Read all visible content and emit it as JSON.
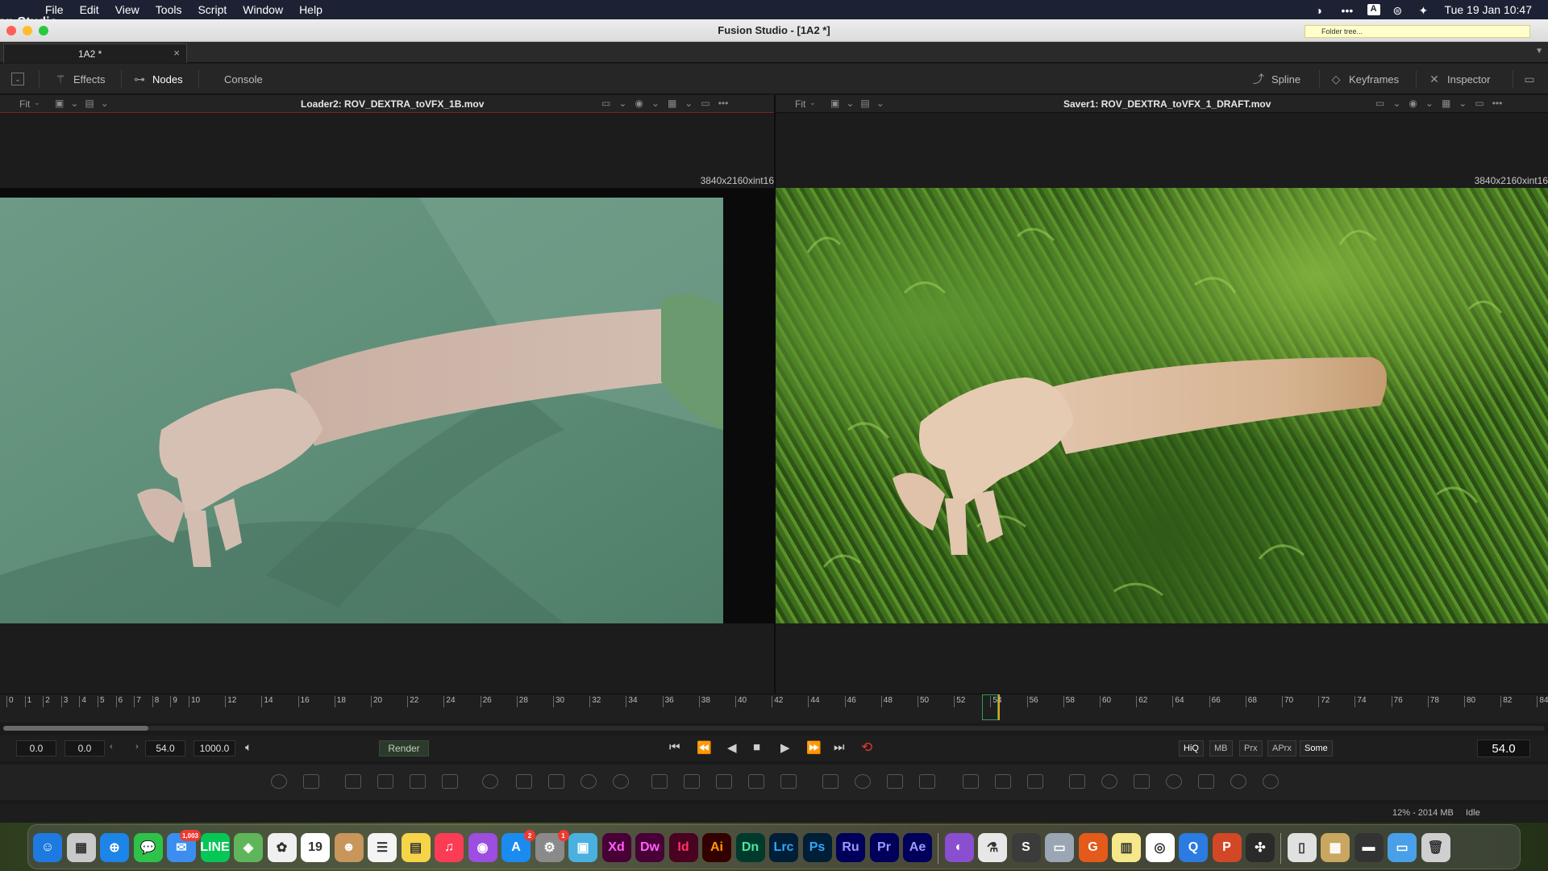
{
  "menubar": {
    "app_name": "Fusion Studio",
    "menus": [
      "File",
      "Edit",
      "View",
      "Tools",
      "Script",
      "Window",
      "Help"
    ],
    "datetime": "Tue 19 Jan  10:47",
    "input_source": "A"
  },
  "window": {
    "title": "Fusion Studio - [1A2 *]",
    "folder_tooltip": "Folder tree..."
  },
  "tab": {
    "label": "1A2 *",
    "close": "×"
  },
  "toolbar": {
    "effects": "Effects",
    "nodes": "Nodes",
    "console": "Console",
    "spline": "Spline",
    "keyframes": "Keyframes",
    "inspector": "Inspector"
  },
  "viewers": {
    "left": {
      "fit": "Fit",
      "title": "Loader2: ROV_DEXTRA_toVFX_1B.mov",
      "resolution": "3840x2160xint16"
    },
    "right": {
      "fit": "Fit",
      "title": "Saver1: ROV_DEXTRA_toVFX_1_DRAFT.mov",
      "resolution": "3840x2160xint16"
    }
  },
  "timeline": {
    "ticks": [
      "0",
      "1",
      "2",
      "3",
      "4",
      "5",
      "6",
      "7",
      "8",
      "9",
      "10",
      "12",
      "14",
      "16",
      "18",
      "20",
      "22",
      "24",
      "26",
      "28",
      "30",
      "32",
      "34",
      "36",
      "38",
      "40",
      "42",
      "44",
      "46",
      "48",
      "50",
      "52",
      "54",
      "56",
      "58",
      "60",
      "62",
      "64",
      "66",
      "68",
      "70",
      "72",
      "74",
      "76",
      "78",
      "80",
      "82",
      "84"
    ],
    "current": 54
  },
  "transport": {
    "global_start": "0.0",
    "render_start": "0.0",
    "render_end": "54.0",
    "global_end": "1000.0",
    "render_label": "Render",
    "hiq": "HiQ",
    "mb": "MB",
    "prx": "Prx",
    "aprx": "APrx",
    "some": "Some",
    "current_frame": "54.0"
  },
  "status": {
    "memory": "12% - 2014 MB",
    "state": "Idle"
  },
  "dock": {
    "apps": [
      {
        "name": "Finder",
        "label": "☺",
        "color": "#1e7ae0"
      },
      {
        "name": "Launchpad",
        "label": "▦",
        "color": "#c9c9c9"
      },
      {
        "name": "Safari",
        "label": "⊕",
        "color": "#1d84e8"
      },
      {
        "name": "Messages",
        "label": "💬",
        "color": "#2ec24a"
      },
      {
        "name": "Mail",
        "label": "✉",
        "color": "#3b8ef0",
        "badge": "1,003"
      },
      {
        "name": "LINE",
        "label": "LINE",
        "color": "#06c755"
      },
      {
        "name": "Maps",
        "label": "◈",
        "color": "#5fb65a"
      },
      {
        "name": "Photos",
        "label": "✿",
        "color": "#f0f0f0"
      },
      {
        "name": "Calendar",
        "label": "19",
        "color": "#ffffff",
        "sub": "JAN"
      },
      {
        "name": "Contacts",
        "label": "☻",
        "color": "#c8955a"
      },
      {
        "name": "Reminders",
        "label": "☰",
        "color": "#f4f4f4"
      },
      {
        "name": "Notes",
        "label": "▤",
        "color": "#f5d44a"
      },
      {
        "name": "Music",
        "label": "♫",
        "color": "#fa3d55"
      },
      {
        "name": "Podcasts",
        "label": "◉",
        "color": "#9b4ee0"
      },
      {
        "name": "App Store",
        "label": "A",
        "color": "#1a8cf0",
        "badge": "2"
      },
      {
        "name": "System Preferences",
        "label": "⚙",
        "color": "#8a8a8a",
        "badge": "1"
      },
      {
        "name": "Preview",
        "label": "▣",
        "color": "#4ab0e0"
      },
      {
        "name": "Adobe XD",
        "label": "Xd",
        "color": "#470137"
      },
      {
        "name": "Dreamweaver",
        "label": "Dw",
        "color": "#470137"
      },
      {
        "name": "InDesign",
        "label": "Id",
        "color": "#49021f"
      },
      {
        "name": "Illustrator",
        "label": "Ai",
        "color": "#330000"
      },
      {
        "name": "Dimension",
        "label": "Dn",
        "color": "#003a2d"
      },
      {
        "name": "Lightroom Classic",
        "label": "Lrc",
        "color": "#001e36"
      },
      {
        "name": "Photoshop",
        "label": "Ps",
        "color": "#001e36"
      },
      {
        "name": "Premiere Rush",
        "label": "Ru",
        "color": "#00005b"
      },
      {
        "name": "Premiere Pro",
        "label": "Pr",
        "color": "#00005b"
      },
      {
        "name": "After Effects",
        "label": "Ae",
        "color": "#00005b"
      },
      {
        "name": "GitHub Desktop",
        "label": "◐",
        "color": "#8a4fd0"
      },
      {
        "name": "Lab",
        "label": "⚗",
        "color": "#e7e7e7"
      },
      {
        "name": "Sublime Text",
        "label": "S",
        "color": "#3b3b3b"
      },
      {
        "name": "Utility",
        "label": "▭",
        "color": "#9aa6b4"
      },
      {
        "name": "Grammarly",
        "label": "G",
        "color": "#e45a1a"
      },
      {
        "name": "Stickies",
        "label": "▥",
        "color": "#f5e88a"
      },
      {
        "name": "Chrome",
        "label": "◎",
        "color": "#ffffff"
      },
      {
        "name": "QuickTime",
        "label": "Q",
        "color": "#2b7be0"
      },
      {
        "name": "PowerPoint",
        "label": "P",
        "color": "#d24726"
      },
      {
        "name": "DaVinci Resolve",
        "label": "✣",
        "color": "#2a2a2a"
      },
      {
        "name": "Document",
        "label": "▯",
        "color": "#e0e0e0"
      },
      {
        "name": "Image",
        "label": "▩",
        "color": "#c9a760"
      },
      {
        "name": "Window",
        "label": "▬",
        "color": "#333"
      },
      {
        "name": "Folder",
        "label": "▭",
        "color": "#4aa0e8"
      },
      {
        "name": "Trash",
        "label": "🗑",
        "color": "#cfcfcf"
      }
    ]
  }
}
